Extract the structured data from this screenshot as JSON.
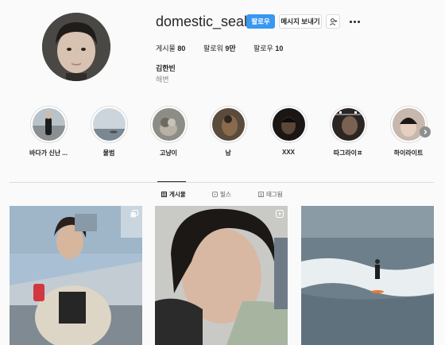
{
  "profile": {
    "username": "domestic_seal",
    "full_name": "김한빈",
    "bio": "해변",
    "stats": {
      "posts_label": "게시물",
      "posts_value": "80",
      "followers_label": "팔로워",
      "followers_value": "9만",
      "following_label": "팔로우",
      "following_value": "10"
    }
  },
  "actions": {
    "follow_label": "팔로우",
    "message_label": "메시지 보내기"
  },
  "highlights": [
    {
      "label": "바다가 신난 ..."
    },
    {
      "label": "물범"
    },
    {
      "label": "고냥이"
    },
    {
      "label": "남"
    },
    {
      "label": "XXX"
    },
    {
      "label": "따그라이ㅍ"
    },
    {
      "label": "하이라이트"
    }
  ],
  "tabs": [
    {
      "label": "게시물",
      "icon": "grid-icon",
      "active": true
    },
    {
      "label": "릴스",
      "icon": "reels-icon",
      "active": false
    },
    {
      "label": "태그됨",
      "icon": "tagged-icon",
      "active": false
    }
  ],
  "colors": {
    "accent": "#3897f0",
    "background": "#fafafa",
    "text": "#262626",
    "muted": "#8e8e8e",
    "border": "#dbdbdb"
  }
}
